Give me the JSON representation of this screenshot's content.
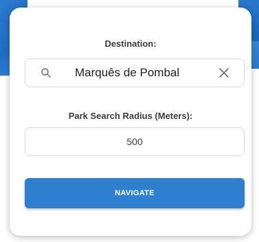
{
  "form": {
    "destination_label": "Destination:",
    "search_value": "Marquês de Pombal",
    "radius_label": "Park Search Radius (Meters):",
    "radius_value": "500",
    "navigate_label": "NAVIGATE"
  },
  "icons": {
    "search": "search-icon",
    "clear": "close-icon"
  },
  "colors": {
    "accent": "#2f80d0",
    "map_water": "#1f6dc4"
  }
}
